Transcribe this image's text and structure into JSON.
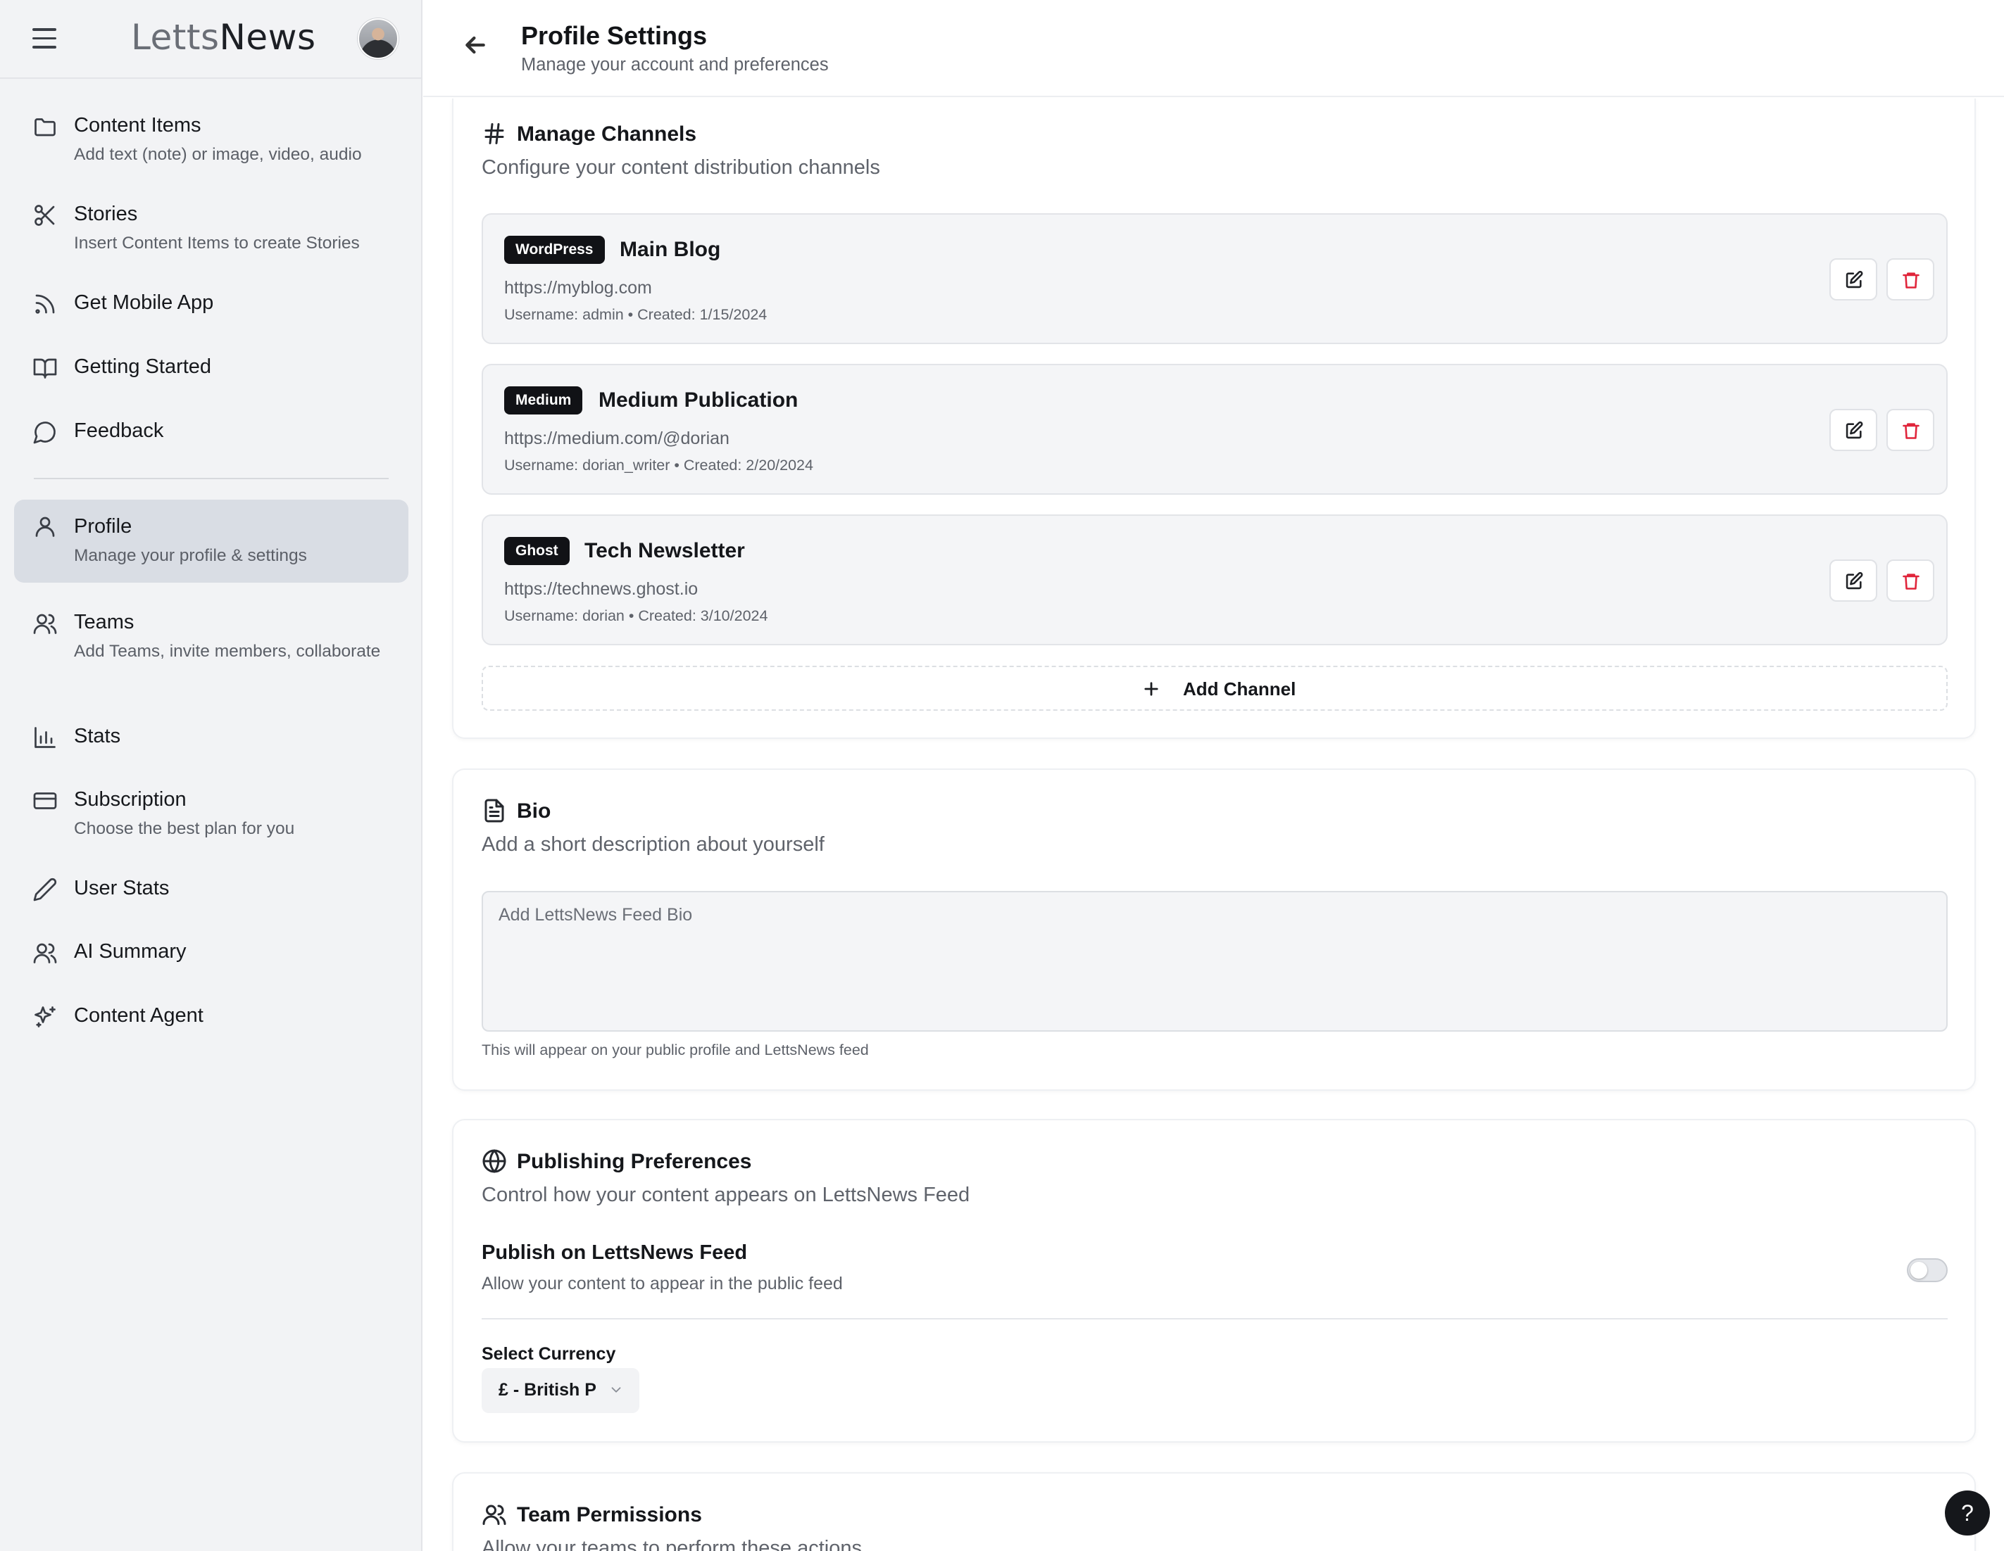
{
  "app": {
    "logo_part1": "Letts",
    "logo_part2": "News"
  },
  "sidebar": {
    "items": [
      {
        "label": "Content Items",
        "sub": "Add text (note) or image, video, audio",
        "icon": "folder-icon"
      },
      {
        "label": "Stories",
        "sub": "Insert Content Items to create Stories",
        "icon": "scissors-icon"
      },
      {
        "label": "Get Mobile App",
        "sub": "",
        "icon": "rss-icon"
      },
      {
        "label": "Getting Started",
        "sub": "",
        "icon": "book-icon"
      },
      {
        "label": "Feedback",
        "sub": "",
        "icon": "message-circle-icon"
      },
      {
        "label": "Profile",
        "sub": "Manage your profile & settings",
        "icon": "user-icon",
        "active": true
      },
      {
        "label": "Teams",
        "sub": "Add Teams, invite members, collaborate",
        "icon": "users-icon"
      },
      {
        "label": "Stats",
        "sub": "",
        "icon": "bar-chart-icon"
      },
      {
        "label": "Subscription",
        "sub": "Choose the best plan for you",
        "icon": "credit-card-icon"
      },
      {
        "label": "User Stats",
        "sub": "",
        "icon": "pen-icon"
      },
      {
        "label": "AI Summary",
        "sub": "",
        "icon": "users-icon"
      },
      {
        "label": "Content Agent",
        "sub": "",
        "icon": "sparkles-icon"
      }
    ]
  },
  "header": {
    "title": "Profile Settings",
    "subtitle": "Manage your account and preferences"
  },
  "channels": {
    "title": "Manage Channels",
    "desc": "Configure your content distribution channels",
    "items": [
      {
        "platform": "WordPress",
        "name": "Main Blog",
        "url": "https://myblog.com",
        "meta": "Username: admin • Created: 1/15/2024"
      },
      {
        "platform": "Medium",
        "name": "Medium Publication",
        "url": "https://medium.com/@dorian",
        "meta": "Username: dorian_writer • Created: 2/20/2024"
      },
      {
        "platform": "Ghost",
        "name": "Tech Newsletter",
        "url": "https://technews.ghost.io",
        "meta": "Username: dorian • Created: 3/10/2024"
      }
    ],
    "add_label": "Add Channel"
  },
  "bio": {
    "title": "Bio",
    "desc": "Add a short description about yourself",
    "placeholder": "Add LettsNews Feed Bio",
    "value": "",
    "help": "This will appear on your public profile and LettsNews feed"
  },
  "publishing": {
    "title": "Publishing Preferences",
    "desc": "Control how your content appears on LettsNews Feed",
    "feed_label": "Publish on LettsNews Feed",
    "feed_sub": "Allow your content to appear in the public feed",
    "feed_enabled": false,
    "currency_label": "Select Currency",
    "currency_value": "£ - British P"
  },
  "team_permissions": {
    "title": "Team Permissions",
    "desc": "Allow your teams to perform these actions"
  },
  "help": {
    "label": "?"
  },
  "colors": {
    "sidebar_bg": "#f2f3f5",
    "active_item_bg": "#d9dde4",
    "badge_bg": "#111216",
    "delete_red": "#e0243a"
  }
}
